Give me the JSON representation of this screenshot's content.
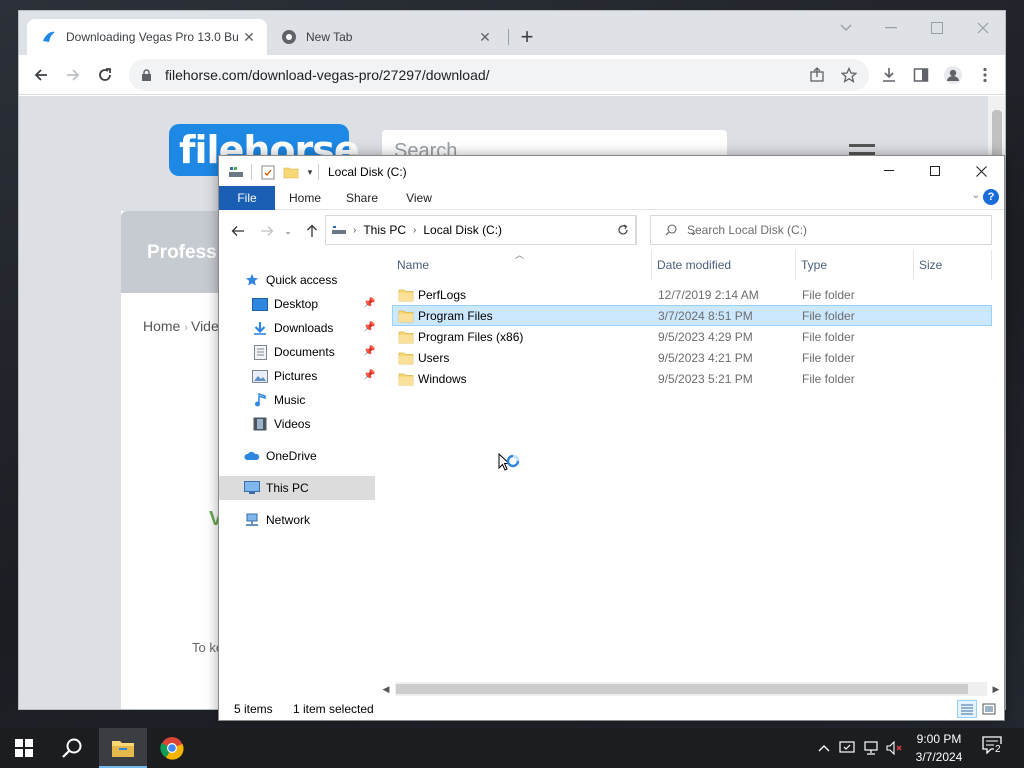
{
  "browser": {
    "tabs": [
      {
        "title": "Downloading Vegas Pro 13.0 Bu",
        "active": true,
        "icon": "filehorse-favicon"
      },
      {
        "title": "New Tab",
        "active": false,
        "icon": "chrome-favicon"
      }
    ],
    "url": "filehorse.com/download-vegas-pro/27297/download/"
  },
  "website": {
    "logo_text": "filehorse",
    "search_placeholder": "Search",
    "banner_text": "Profess",
    "breadcrumb_home": "Home",
    "breadcrumb_next": "Vide",
    "heading_fragment": "V",
    "body_fragment": "To ke"
  },
  "explorer": {
    "title": "Local Disk (C:)",
    "ribbon_tabs": [
      "File",
      "Home",
      "Share",
      "View"
    ],
    "address": [
      "This PC",
      "Local Disk (C:)"
    ],
    "search_placeholder": "Search Local Disk (C:)",
    "nav": {
      "quick_access": "Quick access",
      "desktop": "Desktop",
      "downloads": "Downloads",
      "documents": "Documents",
      "pictures": "Pictures",
      "music": "Music",
      "videos": "Videos",
      "onedrive": "OneDrive",
      "this_pc": "This PC",
      "network": "Network"
    },
    "columns": {
      "name": "Name",
      "date": "Date modified",
      "type": "Type",
      "size": "Size"
    },
    "files": [
      {
        "name": "PerfLogs",
        "date": "12/7/2019 2:14 AM",
        "type": "File folder",
        "selected": false
      },
      {
        "name": "Program Files",
        "date": "3/7/2024 8:51 PM",
        "type": "File folder",
        "selected": true
      },
      {
        "name": "Program Files (x86)",
        "date": "9/5/2023 4:29 PM",
        "type": "File folder",
        "selected": false
      },
      {
        "name": "Users",
        "date": "9/5/2023 4:21 PM",
        "type": "File folder",
        "selected": false
      },
      {
        "name": "Windows",
        "date": "9/5/2023 5:21 PM",
        "type": "File folder",
        "selected": false
      }
    ],
    "status": {
      "items": "5 items",
      "selected": "1 item selected"
    }
  },
  "taskbar": {
    "time": "9:00 PM",
    "date": "3/7/2024",
    "notification_count": "2"
  },
  "colors": {
    "accent": "#1a5fb4",
    "selection": "#cce8ff",
    "folder": "#f8d775",
    "filehorse_blue": "#1e88e5"
  }
}
